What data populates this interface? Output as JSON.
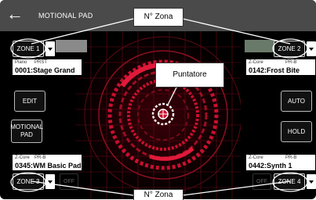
{
  "header": {
    "title": "MOTIONAL PAD",
    "back_icon": "back-arrow-icon"
  },
  "zones": {
    "zone1": {
      "label": "ZONE 1",
      "category": "Piano",
      "bank": "PRST",
      "tone": "0001:Stage Grand"
    },
    "zone2": {
      "label": "ZONE 2",
      "category": "Z-Core",
      "bank": "PR-B",
      "tone": "0142:Frost Bite"
    },
    "zone3": {
      "label": "ZONE 3",
      "category": "Z-Core",
      "bank": "PR-B",
      "tone": "0345:WM Basic Pad",
      "off": "OFF"
    },
    "zone4": {
      "label": "ZONE 4",
      "category": "Z-Core",
      "bank": "PR-B",
      "tone": "0442:Synth 1",
      "off": "OFF"
    }
  },
  "buttons": {
    "edit": "EDIT",
    "motional_pad": "MOTIONAL PAD",
    "auto": "AUTO",
    "hold": "HOLD"
  },
  "callouts": {
    "zone_top": "N° Zona",
    "pointer": "Puntatore",
    "zone_bottom": "N° Zona"
  },
  "colors": {
    "accent_red": "#c8102e",
    "background": "#000000"
  }
}
